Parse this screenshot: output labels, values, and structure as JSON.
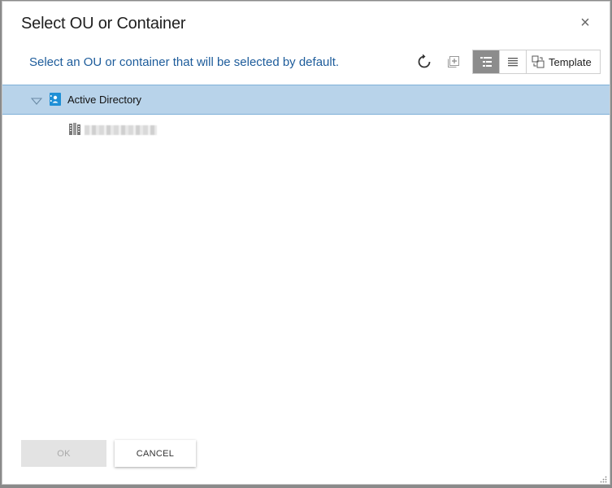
{
  "dialog": {
    "title": "Select OU or Container",
    "close_glyph": "×",
    "subtitle": "Select an OU or container that will be selected by default."
  },
  "toolbar": {
    "refresh_icon": "refresh-icon",
    "expand_all_icon": "expand-all-icon",
    "tree_view_icon": "tree-view-icon",
    "list_view_icon": "list-view-icon",
    "template_label": "Template",
    "active_view": "tree",
    "active_color": "#8c8c8c"
  },
  "tree": {
    "root": {
      "label": "Active Directory",
      "expanded": true,
      "selected": true,
      "selected_bg": "#b8d3ea"
    },
    "children": [
      {
        "label_redacted": true,
        "icon": "domain-icon"
      }
    ]
  },
  "footer": {
    "ok_label": "OK",
    "ok_disabled": true,
    "cancel_label": "CANCEL"
  },
  "colors": {
    "subtitle": "#1d5c9b",
    "ad_icon": "#1e8fd6"
  }
}
